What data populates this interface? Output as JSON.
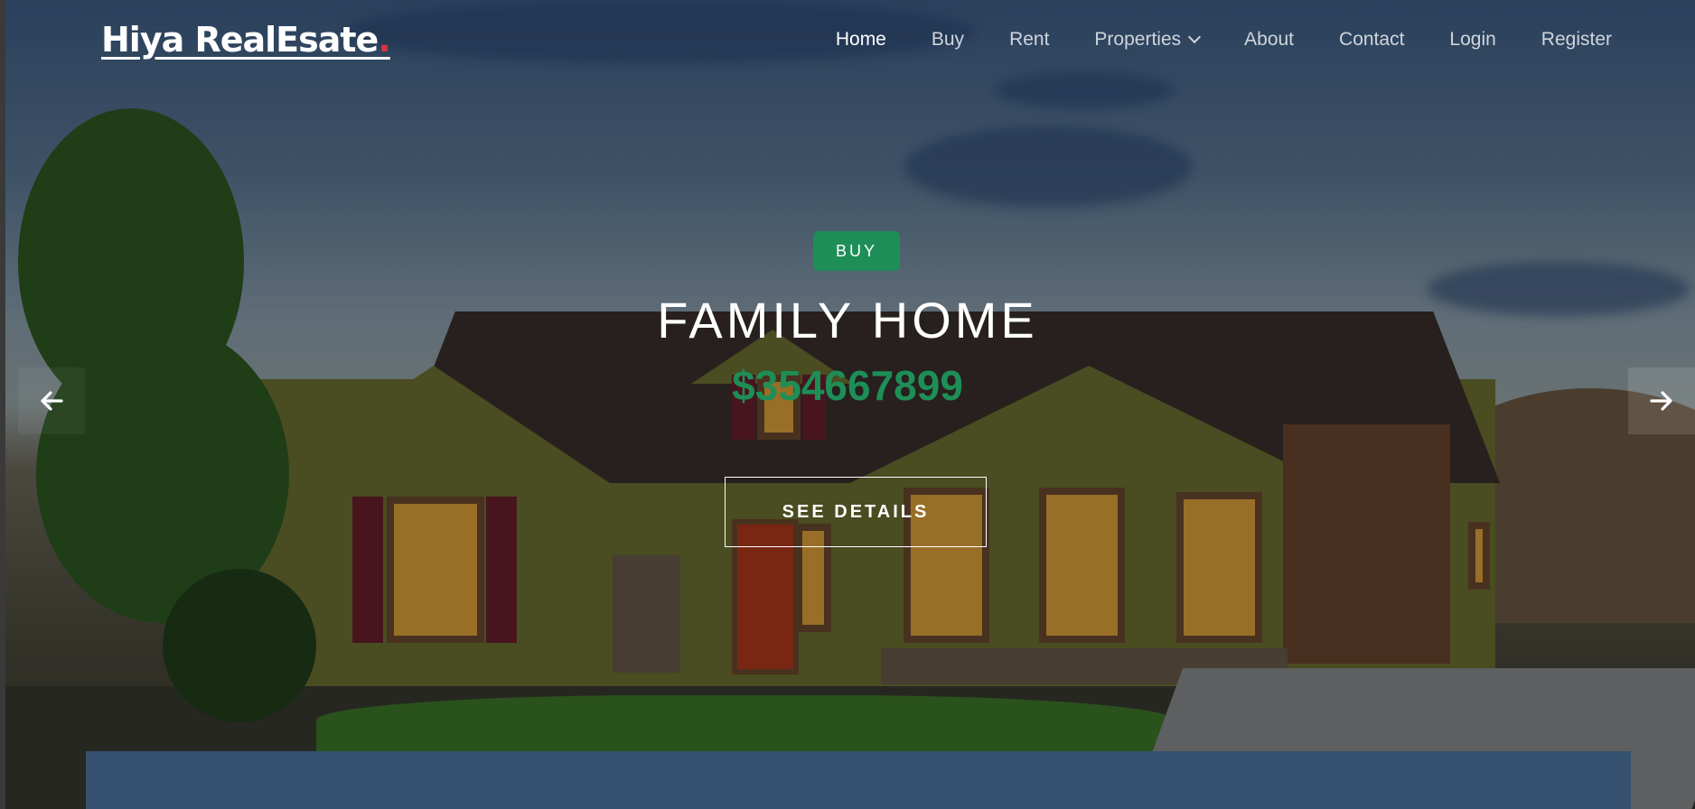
{
  "brand": {
    "name": "Hiya RealEsate",
    "dot": ".",
    "dot_color": "#d8343e"
  },
  "nav": {
    "items": [
      {
        "label": "Home",
        "active": true
      },
      {
        "label": "Buy"
      },
      {
        "label": "Rent"
      },
      {
        "label": "Properties",
        "has_dropdown": true,
        "icon": "chevron-down-icon"
      },
      {
        "label": "About"
      },
      {
        "label": "Contact"
      },
      {
        "label": "Login"
      },
      {
        "label": "Register"
      }
    ]
  },
  "slide": {
    "badge": "BUY",
    "title": "FAMILY HOME",
    "price": "$354667899",
    "button": "SEE DETAILS"
  },
  "carousel": {
    "prev_icon": "arrow-left-icon",
    "next_icon": "arrow-right-icon"
  },
  "colors": {
    "accent": "#1e8e57",
    "band": "#35516f",
    "nav_text": "#cfd5db"
  }
}
